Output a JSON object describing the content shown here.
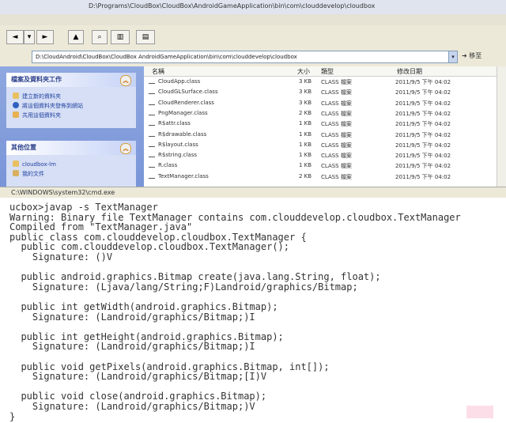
{
  "window": {
    "title": "D:\\Programs\\CloudBox\\CloudBox\\AndroidGameApplication\\bin\\com\\clouddevelop\\cloudbox"
  },
  "address": {
    "value": "D:\\CloudAndroid\\CloudBox\\CloudBox AndroidGameApplication\\bin\\com\\clouddevelop\\cloudbox",
    "go_label": "移至"
  },
  "taskpane": {
    "tasks_title": "檔案及資料夾工作",
    "tasks": [
      "建立新的資料夾",
      "將這個資料夾發佈到網站",
      "共用這個資料夾"
    ],
    "places_title": "其他位置",
    "places": [
      "cloudbox-lm",
      "我的文件"
    ]
  },
  "filelist": {
    "columns": {
      "name": "名稱",
      "size": "大小",
      "type": "類型",
      "date": "修改日期"
    },
    "rows": [
      {
        "name": "CloudApp.class",
        "size": "3 KB",
        "type": "CLASS 檔案",
        "date": "2011/9/5 下午 04:02"
      },
      {
        "name": "CloudGLSurface.class",
        "size": "3 KB",
        "type": "CLASS 檔案",
        "date": "2011/9/5 下午 04:02"
      },
      {
        "name": "CloudRenderer.class",
        "size": "3 KB",
        "type": "CLASS 檔案",
        "date": "2011/9/5 下午 04:02"
      },
      {
        "name": "PngManager.class",
        "size": "2 KB",
        "type": "CLASS 檔案",
        "date": "2011/9/5 下午 04:02"
      },
      {
        "name": "R$attr.class",
        "size": "1 KB",
        "type": "CLASS 檔案",
        "date": "2011/9/5 下午 04:02"
      },
      {
        "name": "R$drawable.class",
        "size": "1 KB",
        "type": "CLASS 檔案",
        "date": "2011/9/5 下午 04:02"
      },
      {
        "name": "R$layout.class",
        "size": "1 KB",
        "type": "CLASS 檔案",
        "date": "2011/9/5 下午 04:02"
      },
      {
        "name": "R$string.class",
        "size": "1 KB",
        "type": "CLASS 檔案",
        "date": "2011/9/5 下午 04:02"
      },
      {
        "name": "R.class",
        "size": "1 KB",
        "type": "CLASS 檔案",
        "date": "2011/9/5 下午 04:02"
      },
      {
        "name": "TextManager.class",
        "size": "2 KB",
        "type": "CLASS 檔案",
        "date": "2011/9/5 下午 04:02"
      }
    ]
  },
  "cmd": {
    "title": "C:\\WINDOWS\\system32\\cmd.exe",
    "lines": [
      "ucbox>javap -s TextManager",
      "Warning: Binary file TextManager contains com.clouddevelop.cloudbox.TextManager",
      "Compiled from \"TextManager.java\"",
      "public class com.clouddevelop.cloudbox.TextManager {",
      "  public com.clouddevelop.cloudbox.TextManager();",
      "    Signature: ()V",
      "",
      "  public android.graphics.Bitmap create(java.lang.String, float);",
      "    Signature: (Ljava/lang/String;F)Landroid/graphics/Bitmap;",
      "",
      "  public int getWidth(android.graphics.Bitmap);",
      "    Signature: (Landroid/graphics/Bitmap;)I",
      "",
      "  public int getHeight(android.graphics.Bitmap);",
      "    Signature: (Landroid/graphics/Bitmap;)I",
      "",
      "  public void getPixels(android.graphics.Bitmap, int[]);",
      "    Signature: (Landroid/graphics/Bitmap;[I)V",
      "",
      "  public void close(android.graphics.Bitmap);",
      "    Signature: (Landroid/graphics/Bitmap;)V",
      "}"
    ]
  },
  "colors": {
    "taskpane": "#7a95d8",
    "link": "#2040a0",
    "console_bg": "#ffffff"
  }
}
